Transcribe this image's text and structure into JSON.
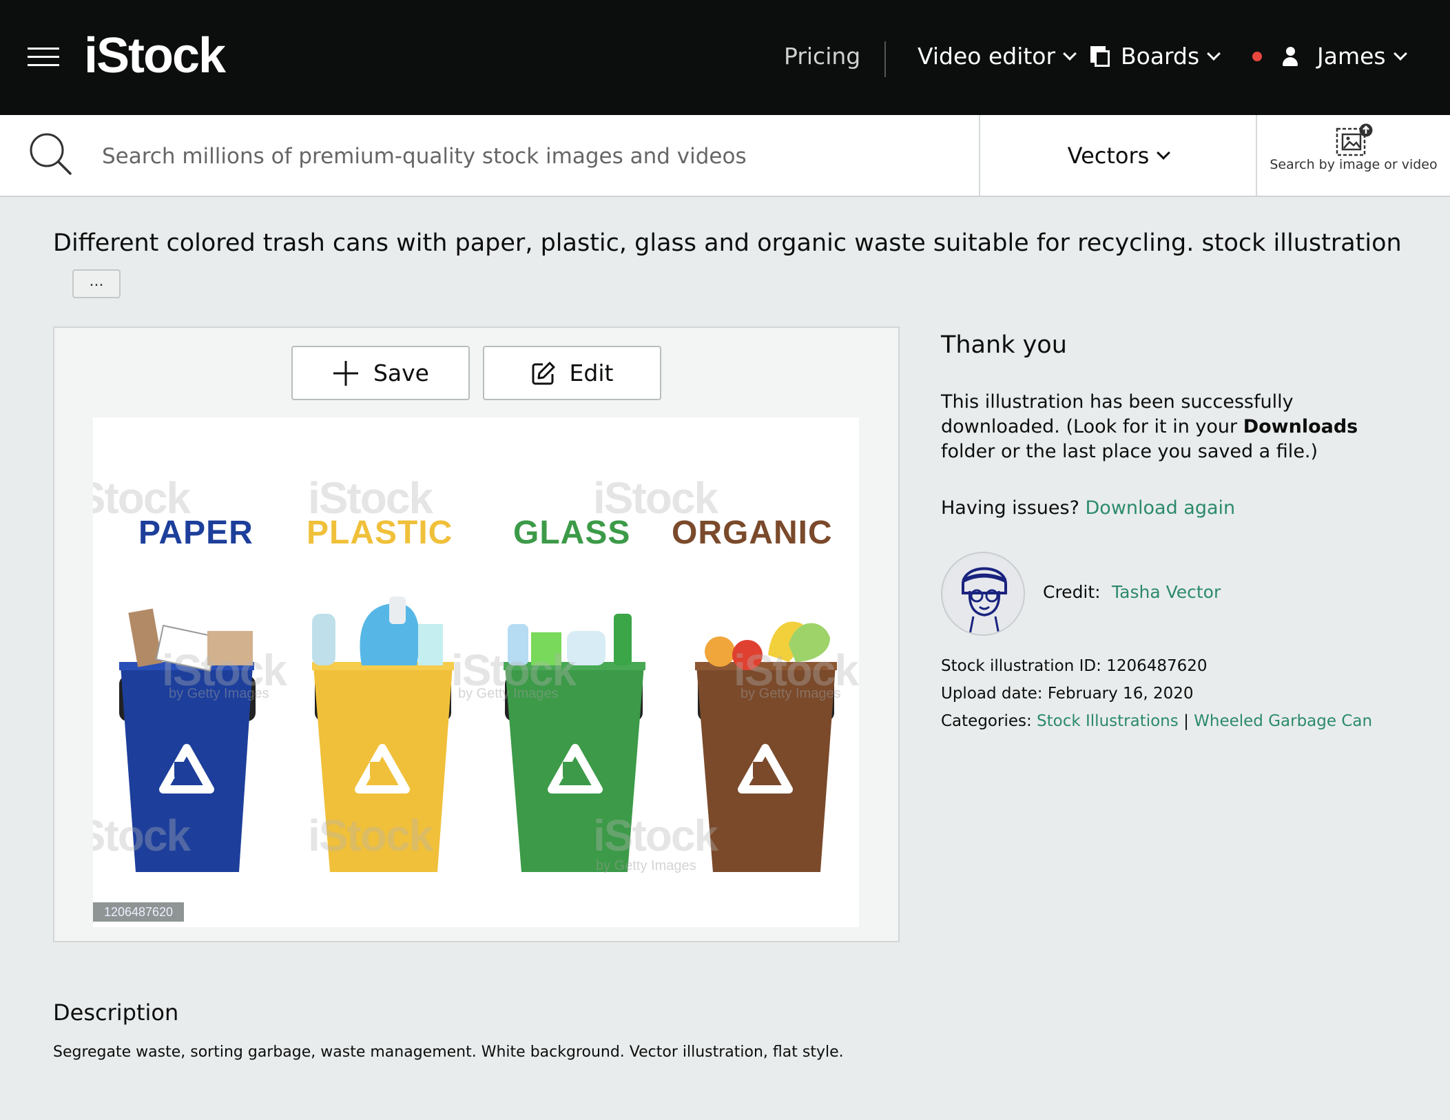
{
  "header": {
    "logo": "iStock",
    "pricing": "Pricing",
    "video_editor": "Video editor",
    "boards": "Boards",
    "user": "James"
  },
  "search": {
    "placeholder": "Search millions of premium-quality stock images and videos",
    "type_selected": "Vectors",
    "image_search_label": "Search by image or video"
  },
  "asset": {
    "title": "Different colored trash cans with paper, plastic, glass and organic waste suitable for recycling. stock illustration",
    "more_label": "...",
    "save_label": "Save",
    "edit_label": "Edit",
    "preview_id": "1206487620",
    "watermark": "iStock",
    "watermark_sub": "by Getty Images",
    "bins": [
      {
        "label": "PAPER",
        "color": "#1d3f9b"
      },
      {
        "label": "PLASTIC",
        "color": "#f0c03a"
      },
      {
        "label": "GLASS",
        "color": "#3c9a48"
      },
      {
        "label": "ORGANIC",
        "color": "#7a4a2b"
      }
    ]
  },
  "download": {
    "heading": "Thank you",
    "text_before": "This illustration has been successfully downloaded. (Look for it in your ",
    "text_bold": "Downloads",
    "text_after": " folder or the last place you saved a file.)",
    "issues_prefix": "Having issues?",
    "download_again": "Download again",
    "credit_label": "Credit:",
    "credit_name": "Tasha Vector",
    "id_label": "Stock illustration ID:",
    "id_value": "1206487620",
    "upload_label": "Upload date:",
    "upload_value": "February 16, 2020",
    "categories_label": "Categories:",
    "category_1": "Stock Illustrations",
    "category_sep": "|",
    "category_2": "Wheeled Garbage Can"
  },
  "description": {
    "heading": "Description",
    "text": "Segregate waste, sorting garbage, waste management. White background. Vector illustration, flat style."
  },
  "colors": {
    "topbar": "#0c0d0d",
    "page_bg": "#e9ecec",
    "link": "#2b8a6b",
    "notification": "#e8473f"
  }
}
